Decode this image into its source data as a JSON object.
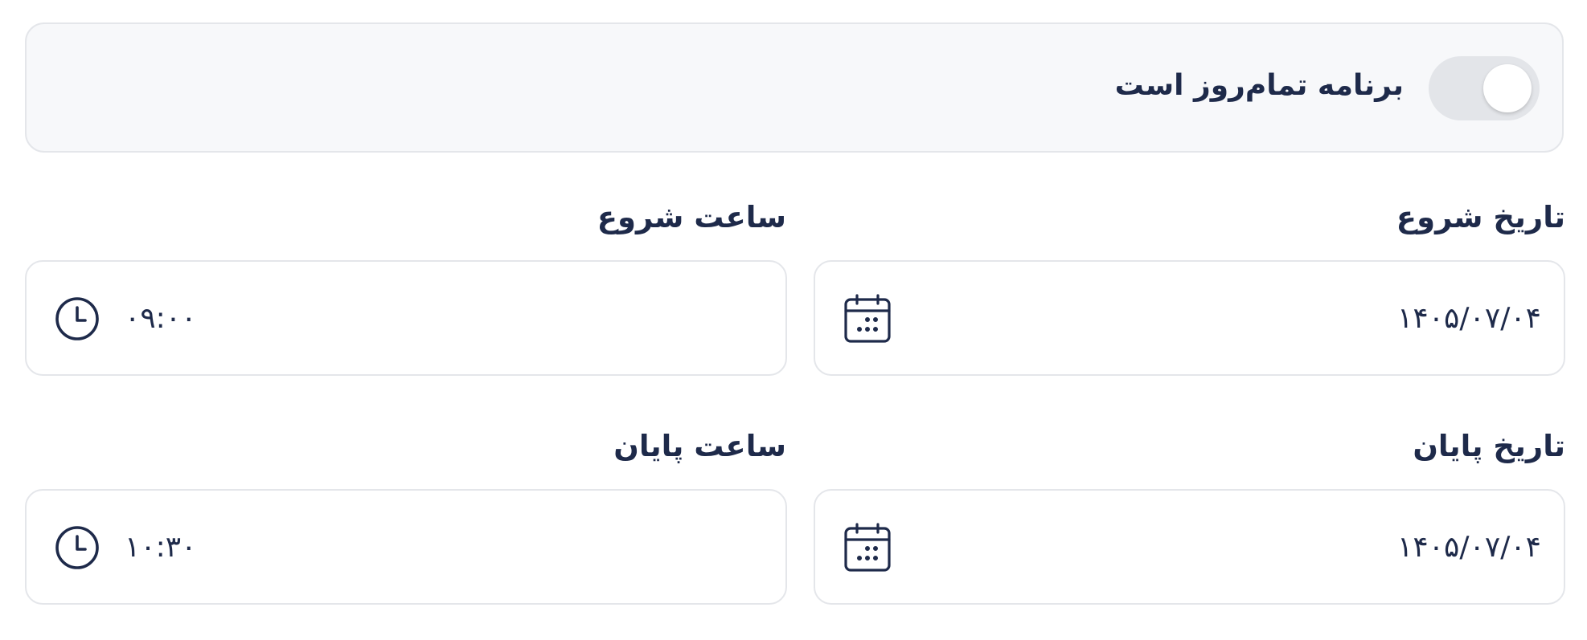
{
  "all_day": {
    "label": "برنامه تمام‌روز است",
    "enabled": false
  },
  "start_date": {
    "label": "تاریخ شروع",
    "value": "۱۴۰۵/۰۷/۰۴",
    "icon": "calendar-icon"
  },
  "start_time": {
    "label": "ساعت شروع",
    "value": "۰۹:۰۰",
    "icon": "clock-icon"
  },
  "end_date": {
    "label": "تاریخ پایان",
    "value": "۱۴۰۵/۰۷/۰۴",
    "icon": "calendar-icon"
  },
  "end_time": {
    "label": "ساعت پایان",
    "value": "۱۰:۳۰",
    "icon": "clock-icon"
  },
  "colors": {
    "text": "#1e2a4a",
    "border": "#e4e6ea",
    "card_bg": "#f7f8fa",
    "toggle_off": "#e3e5e9"
  }
}
